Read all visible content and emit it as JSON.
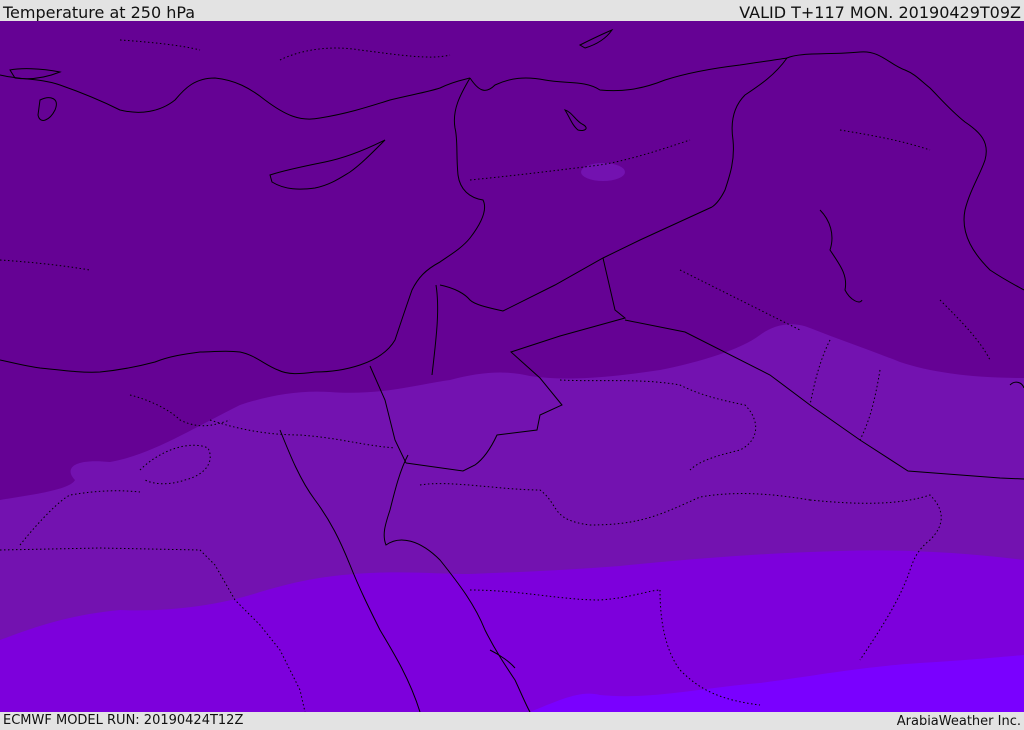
{
  "header": {
    "title": "Temperature at 250 hPa",
    "valid": "VALID T+117 MON. 20190429T09Z"
  },
  "footer": {
    "model_run": "ECMWF MODEL RUN: 20190424T12Z",
    "credit": "ArabiaWeather Inc."
  },
  "map": {
    "parameter": "temperature",
    "level": "250 hPa",
    "colors": {
      "band_coldest": "#650294",
      "band_2": "#7312b0",
      "band_3": "#7d00dc",
      "band_warmest": "#7a00ff",
      "coastline": "#000000",
      "border": "#000000"
    }
  }
}
